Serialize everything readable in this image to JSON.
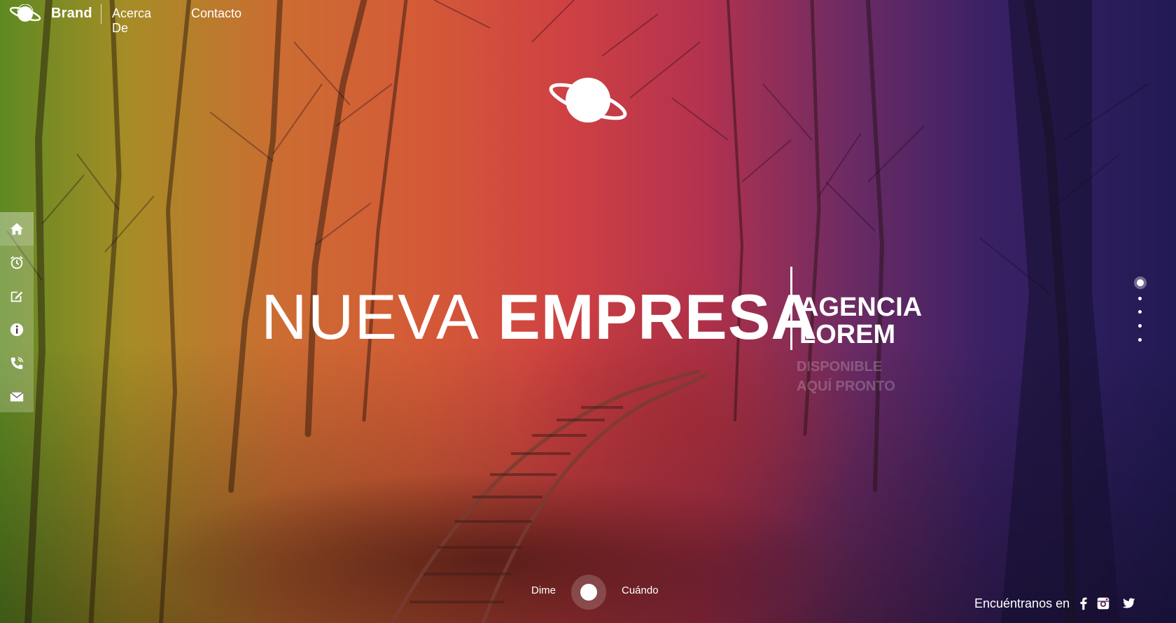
{
  "nav": {
    "brand": "Brand",
    "links": [
      "Acerca De",
      "Contacto"
    ]
  },
  "hero": {
    "title_light": "NUEVA",
    "title_bold": "EMPRESA",
    "agency_line1": "AGENCIA",
    "agency_line2": "LOREM",
    "tagline_line1": "DISPONIBLE",
    "tagline_line2": "AQUÍ PRONTO"
  },
  "sidebar": {
    "items": [
      {
        "icon": "home-icon",
        "active": true
      },
      {
        "icon": "alarm-clock-icon"
      },
      {
        "icon": "edit-icon"
      },
      {
        "icon": "info-icon"
      },
      {
        "icon": "phone-icon"
      },
      {
        "icon": "mail-icon"
      }
    ]
  },
  "pager": {
    "count": 5,
    "active": 0
  },
  "toggle": {
    "left_label": "Dime",
    "right_label": "Cuándo"
  },
  "social": {
    "label": "Encuéntranos en",
    "icons": [
      "facebook-icon",
      "instagram-icon",
      "twitter-icon"
    ]
  },
  "colors": {
    "gradient": [
      "#5e8a22",
      "#a78c26",
      "#cc6c32",
      "#cf4142",
      "#b3324f",
      "#3a2166",
      "#221a54"
    ],
    "text": "#ffffff"
  }
}
